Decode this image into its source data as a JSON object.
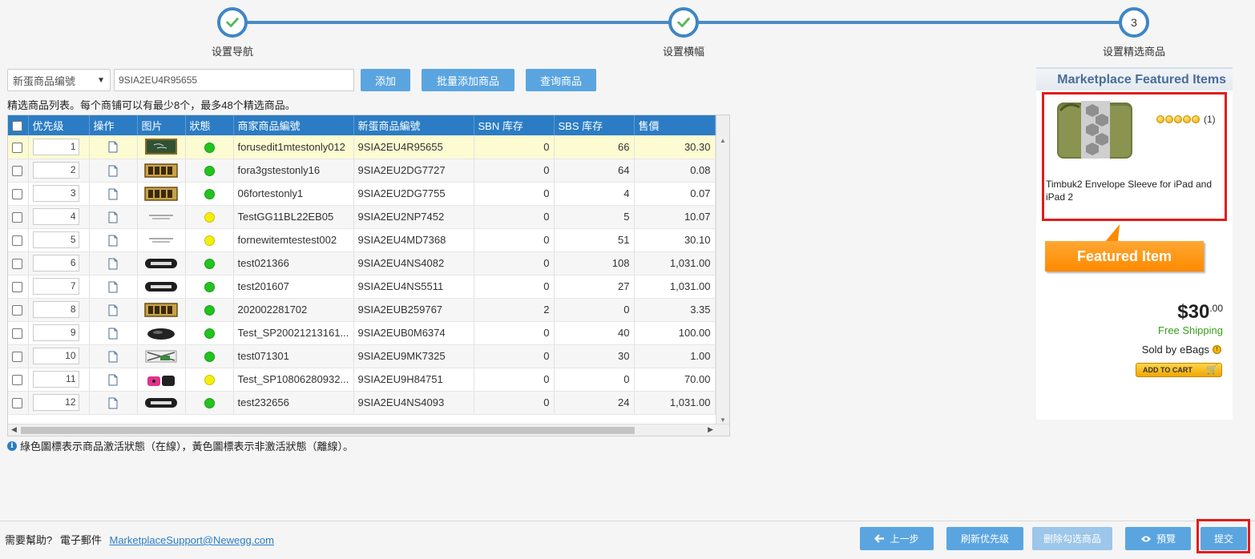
{
  "steps": [
    {
      "label": "设置导航",
      "state": "done"
    },
    {
      "label": "设置横幅",
      "state": "done"
    },
    {
      "label": "设置精选商品",
      "state": "current",
      "number": "3"
    }
  ],
  "search": {
    "select_value": "新蛋商品编號",
    "input_value": "9SIA2EU4R95655",
    "add_label": "添加",
    "bulk_add_label": "批量添加商品",
    "query_label": "查询商品"
  },
  "hint": "精选商品列表。每个商铺可以有最少8个，最多48个精选商品。",
  "table": {
    "headers": [
      "",
      "优先级",
      "操作",
      "图片",
      "狀態",
      "商家商品編號",
      "新蛋商品編號",
      "SBN 库存",
      "SBS 库存",
      "售價"
    ],
    "rows": [
      {
        "priority": "1",
        "status": "green",
        "seller_id": "forusedit1mtestonly012",
        "newegg_id": "9SIA2EU4R95655",
        "sbn": "0",
        "sbs": "66",
        "price": "30.30",
        "thumb": "chalkboard"
      },
      {
        "priority": "2",
        "status": "green",
        "seller_id": "fora3gstestonly16",
        "newegg_id": "9SIA2EU2DG7727",
        "sbn": "0",
        "sbs": "64",
        "price": "0.08",
        "thumb": "test-gold"
      },
      {
        "priority": "3",
        "status": "green",
        "seller_id": "06fortestonly1",
        "newegg_id": "9SIA2EU2DG7755",
        "sbn": "0",
        "sbs": "4",
        "price": "0.07",
        "thumb": "test-gold"
      },
      {
        "priority": "4",
        "status": "yellow",
        "seller_id": "TestGG11BL22EB05",
        "newegg_id": "9SIA2EU2NP7452",
        "sbn": "0",
        "sbs": "5",
        "price": "10.07",
        "thumb": "text-small"
      },
      {
        "priority": "5",
        "status": "yellow",
        "seller_id": "fornewitemtestest002",
        "newegg_id": "9SIA2EU4MD7368",
        "sbn": "0",
        "sbs": "51",
        "price": "30.10",
        "thumb": "text-small"
      },
      {
        "priority": "6",
        "status": "green",
        "seller_id": "test021366",
        "newegg_id": "9SIA2EU4NS4082",
        "sbn": "0",
        "sbs": "108",
        "price": "1,031.00",
        "thumb": "test-pill"
      },
      {
        "priority": "7",
        "status": "green",
        "seller_id": "test201607",
        "newegg_id": "9SIA2EU4NS5511",
        "sbn": "0",
        "sbs": "27",
        "price": "1,031.00",
        "thumb": "test-pill"
      },
      {
        "priority": "8",
        "status": "green",
        "seller_id": "202002281702",
        "newegg_id": "9SIA2EUB259767",
        "sbn": "2",
        "sbs": "0",
        "price": "3.35",
        "thumb": "test-gold"
      },
      {
        "priority": "9",
        "status": "green",
        "seller_id": "Test_SP20021213161...",
        "newegg_id": "9SIA2EUB0M6374",
        "sbn": "0",
        "sbs": "40",
        "price": "100.00",
        "thumb": "mouse"
      },
      {
        "priority": "10",
        "status": "green",
        "seller_id": "test071301",
        "newegg_id": "9SIA2EU9MK7325",
        "sbn": "0",
        "sbs": "30",
        "price": "1.00",
        "thumb": "cables"
      },
      {
        "priority": "11",
        "status": "yellow",
        "seller_id": "Test_SP10806280932...",
        "newegg_id": "9SIA2EU9H84751",
        "sbn": "0",
        "sbs": "0",
        "price": "70.00",
        "thumb": "bags"
      },
      {
        "priority": "12",
        "status": "green",
        "seller_id": "test232656",
        "newegg_id": "9SIA2EU4NS4093",
        "sbn": "0",
        "sbs": "24",
        "price": "1,031.00",
        "thumb": "test-pill"
      }
    ]
  },
  "info_note": "綠色圖標表示商品激活狀態（在線），黃色圖標表示非激活狀態（離線）。",
  "preview": {
    "header": "Marketplace Featured Items",
    "rating_count": "(1)",
    "rating_stars": 5,
    "product_title": "Timbuk2 Envelope Sleeve for iPad and iPad 2",
    "callout": "Featured Item",
    "price_dollars": "$30",
    "price_cents": ".00",
    "shipping": "Free Shipping",
    "sold_by_label": "Sold by",
    "seller": "eBags",
    "add_to_cart": "ADD TO CART"
  },
  "footer": {
    "help_label": "需要幫助?",
    "email_label": "電子郵件",
    "email": "MarketplaceSupport@Newegg.com",
    "prev_label": "上一步",
    "refresh_label": "刷新优先级",
    "delete_label": "删除勾选商品",
    "preview_label": "預覽",
    "submit_label": "提交"
  },
  "colors": {
    "accent": "#2b7cc4",
    "button": "#5aa5e0",
    "highlight_border": "#e21c1c",
    "callout": "#ff8a00"
  }
}
